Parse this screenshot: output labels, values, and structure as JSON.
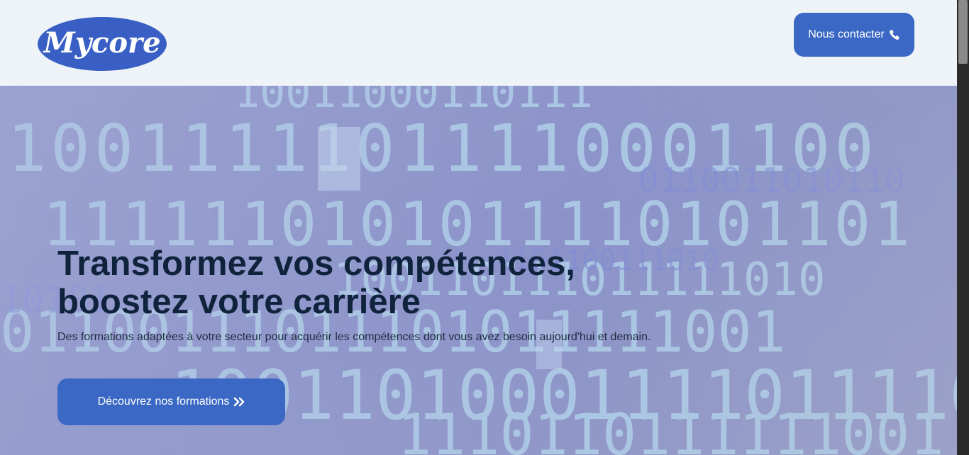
{
  "header": {
    "logo_text": "Mycore",
    "contact_label": "Nous contacter",
    "contact_icon": "phone-icon"
  },
  "hero": {
    "title_line1": "Transformez vos compétences,",
    "title_line2": "boostez votre carrière",
    "subtitle": "Des formations adaptées à votre secteur pour acquérir les compétences dont vous avez besoin aujourd'hui et demain.",
    "cta_label": "Découvrez nos formations",
    "cta_icon": "double-chevron-right-icon"
  },
  "colors": {
    "accent": "#3a68c4",
    "header_bg": "#eef3f7",
    "title": "#10233d"
  }
}
